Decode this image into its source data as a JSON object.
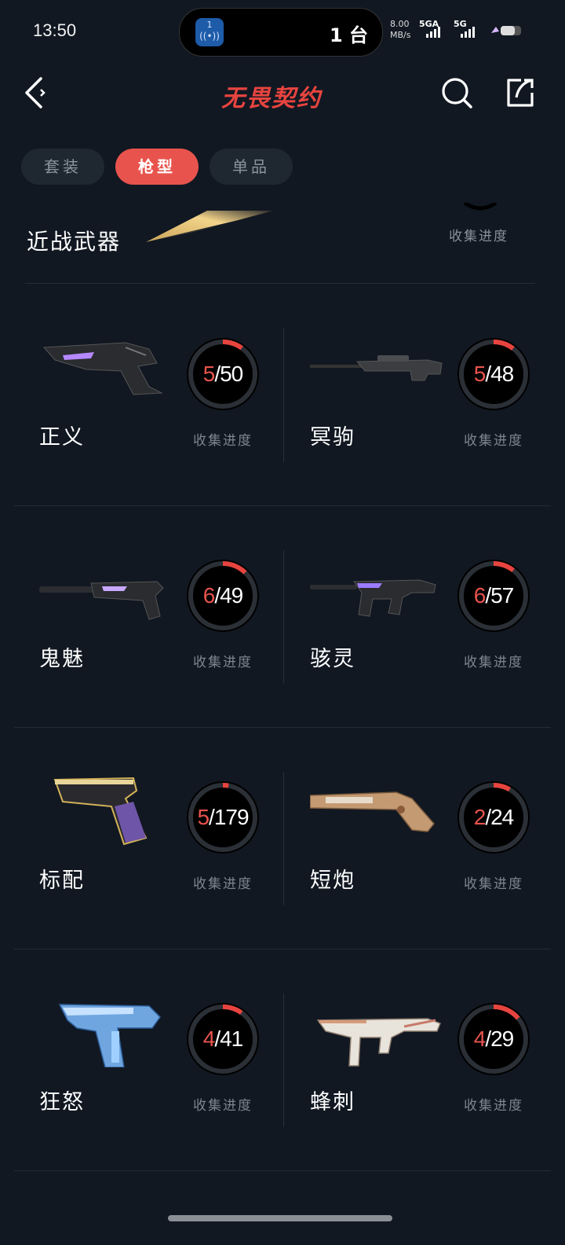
{
  "status_bar": {
    "time": "13:50",
    "island_badge": "1",
    "island_text": "1 台",
    "net_speed": "8.00",
    "net_unit": "MB/s",
    "sim1": "5GA",
    "sim2": "5G"
  },
  "header": {
    "title": "无畏契约",
    "accent_color": "#e8443f"
  },
  "tabs": [
    {
      "label": "套装",
      "active": false
    },
    {
      "label": "枪型",
      "active": true
    },
    {
      "label": "单品",
      "active": false
    }
  ],
  "melee": {
    "label": "近战武器",
    "progress_label": "收集进度"
  },
  "weapons": [
    {
      "name": "正义",
      "collected": "5",
      "total": "50",
      "progress_label": "收集进度",
      "fraction": 0.1,
      "icon": "revolver-icon"
    },
    {
      "name": "冥驹",
      "collected": "5",
      "total": "48",
      "progress_label": "收集进度",
      "fraction": 0.104,
      "icon": "sniper-icon"
    },
    {
      "name": "鬼魅",
      "collected": "6",
      "total": "49",
      "progress_label": "收集进度",
      "fraction": 0.122,
      "icon": "silenced-pistol-icon"
    },
    {
      "name": "骇灵",
      "collected": "6",
      "total": "57",
      "progress_label": "收集进度",
      "fraction": 0.105,
      "icon": "smg-icon"
    },
    {
      "name": "标配",
      "collected": "5",
      "total": "179",
      "progress_label": "收集进度",
      "fraction": 0.028,
      "icon": "pistol-icon"
    },
    {
      "name": "短炮",
      "collected": "2",
      "total": "24",
      "progress_label": "收集进度",
      "fraction": 0.083,
      "icon": "shorty-icon"
    },
    {
      "name": "狂怒",
      "collected": "4",
      "total": "41",
      "progress_label": "收集进度",
      "fraction": 0.098,
      "icon": "frenzy-icon"
    },
    {
      "name": "蜂刺",
      "collected": "4",
      "total": "29",
      "progress_label": "收集进度",
      "fraction": 0.138,
      "icon": "stinger-icon"
    }
  ]
}
